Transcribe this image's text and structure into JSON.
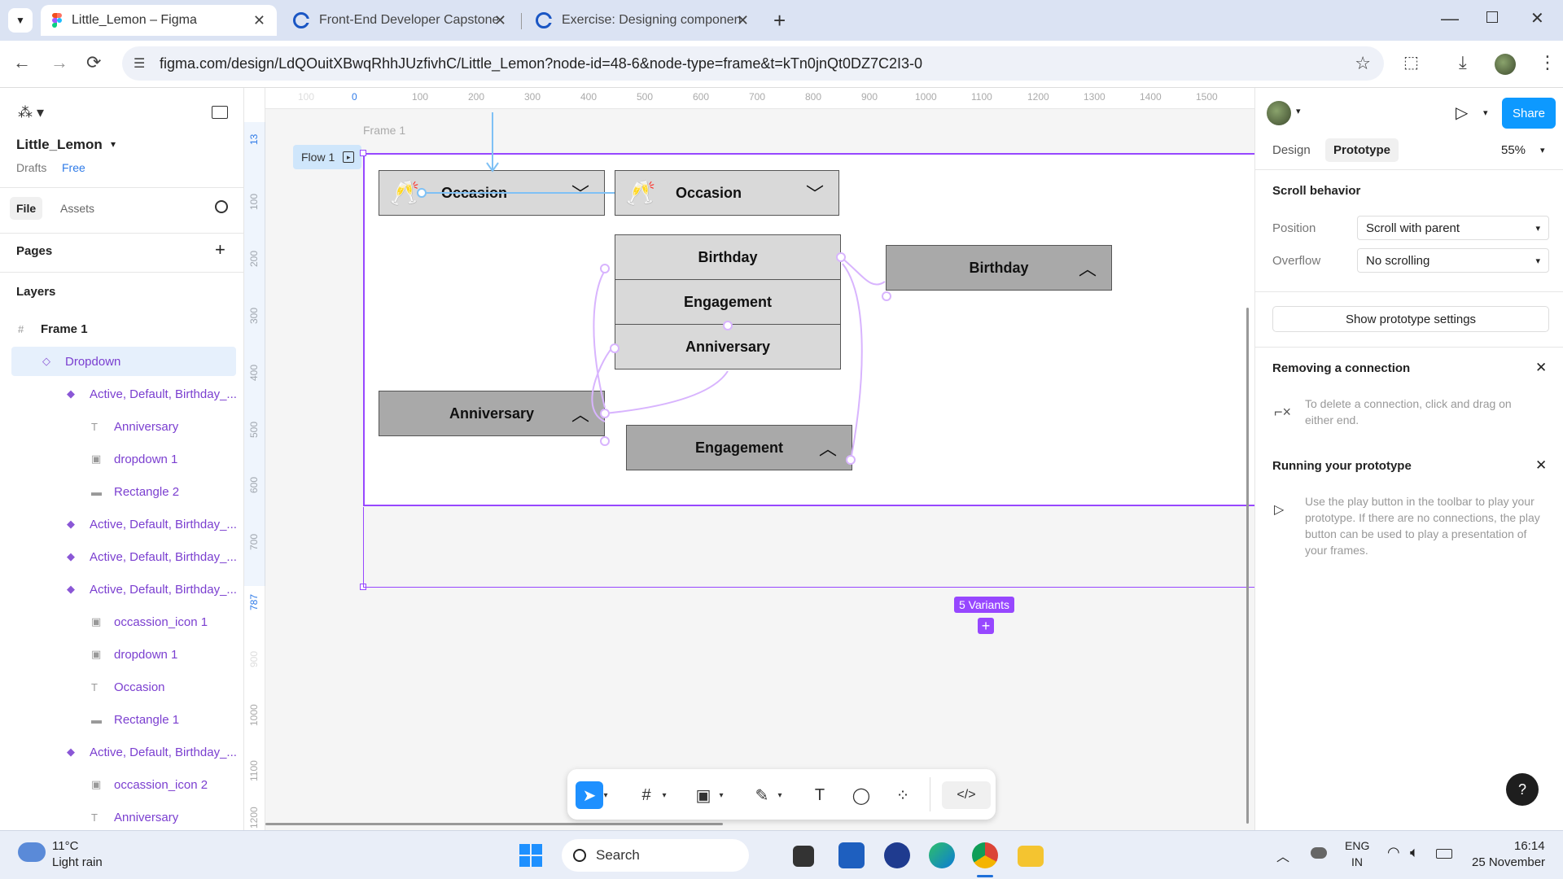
{
  "browser": {
    "tabs": [
      {
        "title": "Little_Lemon – Figma",
        "icon": "figma-icon",
        "active": true
      },
      {
        "title": "Front-End Developer Capstone",
        "icon": "coursera-icon",
        "active": false
      },
      {
        "title": "Exercise: Designing component",
        "icon": "coursera-icon",
        "active": false
      }
    ],
    "url": "figma.com/design/LdQOuitXBwqRhhJUzfivhC/Little_Lemon?node-id=48-6&node-type=frame&t=kTn0jnQt0DZ7C2I3-0"
  },
  "left_panel": {
    "file_name": "Little_Lemon",
    "location": "Drafts",
    "plan_badge": "Free",
    "tabs": [
      "File",
      "Assets"
    ],
    "pages_label": "Pages",
    "layers_label": "Layers",
    "layers": [
      {
        "name": "Frame 1",
        "icon": "frame-icon"
      },
      {
        "name": "Dropdown",
        "icon": "component-set-icon"
      },
      {
        "name": "Active, Default, Birthday_...",
        "icon": "variant-icon"
      },
      {
        "name": "Anniversary",
        "icon": "text-icon"
      },
      {
        "name": "dropdown 1",
        "icon": "image-icon"
      },
      {
        "name": "Rectangle 2",
        "icon": "rectangle-icon"
      },
      {
        "name": "Active, Default, Birthday_...",
        "icon": "variant-icon"
      },
      {
        "name": "Active, Default, Birthday_...",
        "icon": "variant-icon"
      },
      {
        "name": "Active, Default, Birthday_...",
        "icon": "variant-icon"
      },
      {
        "name": "occassion_icon 1",
        "icon": "image-icon"
      },
      {
        "name": "dropdown 1",
        "icon": "image-icon"
      },
      {
        "name": "Occasion",
        "icon": "text-icon"
      },
      {
        "name": "Rectangle 1",
        "icon": "rectangle-icon"
      },
      {
        "name": "Active, Default, Birthday_...",
        "icon": "variant-icon"
      },
      {
        "name": "occassion_icon 2",
        "icon": "image-icon"
      },
      {
        "name": "Anniversary",
        "icon": "text-icon"
      }
    ]
  },
  "canvas": {
    "frame_label": "Frame 1",
    "flow_label": "Flow 1",
    "variants_badge": "5 Variants",
    "ruler_top": [
      "100",
      "0",
      "100",
      "200",
      "300",
      "400",
      "500",
      "600",
      "700",
      "800",
      "900",
      "1000",
      "1100",
      "1200",
      "1300",
      "1400",
      "1500"
    ],
    "ruler_left": [
      "13",
      "100",
      "200",
      "300",
      "400",
      "500",
      "600",
      "700",
      "787",
      "900",
      "1000",
      "1100",
      "1200"
    ],
    "components": {
      "occasion_1": "Occasion",
      "occasion_2": "Occasion",
      "list_birthday": "Birthday",
      "list_engagement": "Engagement",
      "list_anniversary": "Anniversary",
      "birthday": "Birthday",
      "anniversary": "Anniversary",
      "engagement": "Engagement"
    }
  },
  "right_panel": {
    "tabs": [
      "Design",
      "Prototype"
    ],
    "active_tab": "Prototype",
    "zoom": "55%",
    "share_label": "Share",
    "scroll_behavior": {
      "title": "Scroll behavior",
      "position_label": "Position",
      "position_value": "Scroll with parent",
      "overflow_label": "Overflow",
      "overflow_value": "No scrolling"
    },
    "show_settings_label": "Show prototype settings",
    "tips": [
      {
        "title": "Removing a connection",
        "body": "To delete a connection, click and drag on either end."
      },
      {
        "title": "Running your prototype",
        "body": "Use the play button in the toolbar to play your prototype. If there are no connections, the play button can be used to play a presentation of your frames."
      }
    ],
    "help_label": "?"
  },
  "taskbar": {
    "weather_temp": "11°C",
    "weather_desc": "Light rain",
    "search_placeholder": "Search",
    "lang_line1": "ENG",
    "lang_line2": "IN",
    "time": "16:14",
    "date": "25 November"
  }
}
